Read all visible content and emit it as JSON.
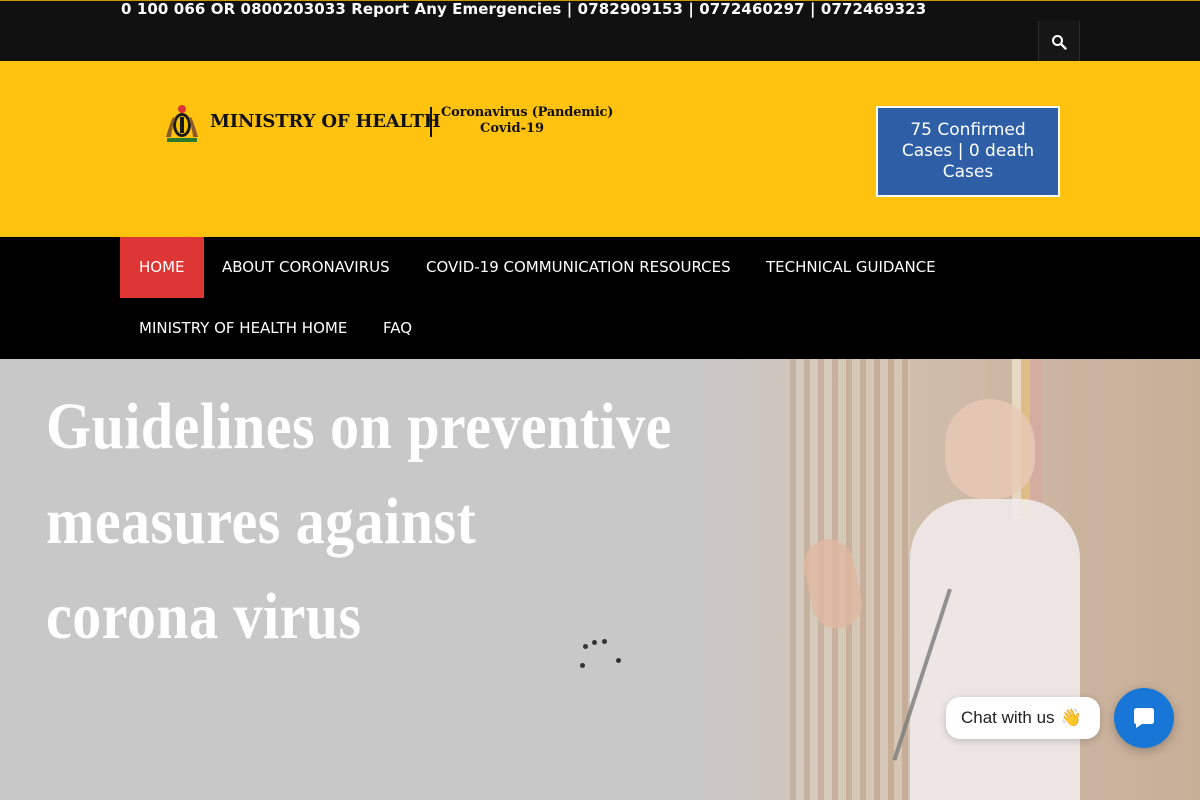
{
  "topbar": {
    "ticker": "0 100 066 OR 0800203033 Report Any Emergencies | 0782909153 | 0772460297 | 0772469323",
    "search_icon": "search-icon"
  },
  "header": {
    "logo": {
      "org_name": "MINISTRY OF HEALTH",
      "subtitle_line1": "Coronavirus (Pandemic)",
      "subtitle_line2": "Covid-19",
      "crest_icon": "coat-of-arms-icon"
    },
    "cases_button": "75 Confirmed Cases | 0 death Cases",
    "colors": {
      "header_bg": "#ffc20e",
      "cases_bg": "#2e5fa6"
    }
  },
  "nav": {
    "items": [
      {
        "label": "HOME",
        "active": true
      },
      {
        "label": "ABOUT CORONAVIRUS",
        "active": false
      },
      {
        "label": "COVID-19 COMMUNICATION RESOURCES",
        "active": false
      },
      {
        "label": "TECHNICAL GUIDANCE",
        "active": false
      },
      {
        "label": "MINISTRY OF HEALTH HOME",
        "active": false
      },
      {
        "label": "FAQ",
        "active": false
      }
    ],
    "colors": {
      "bg": "#000000",
      "active_bg": "#de3535"
    }
  },
  "hero": {
    "headline_lines": [
      "Guidelines on preventive",
      "measures against",
      "corona virus"
    ],
    "loading_icon": "loading-spinner-icon"
  },
  "chat": {
    "label": "Chat with us",
    "emoji": "👋",
    "button_icon": "chat-bubble-icon",
    "color": "#1877d6"
  }
}
